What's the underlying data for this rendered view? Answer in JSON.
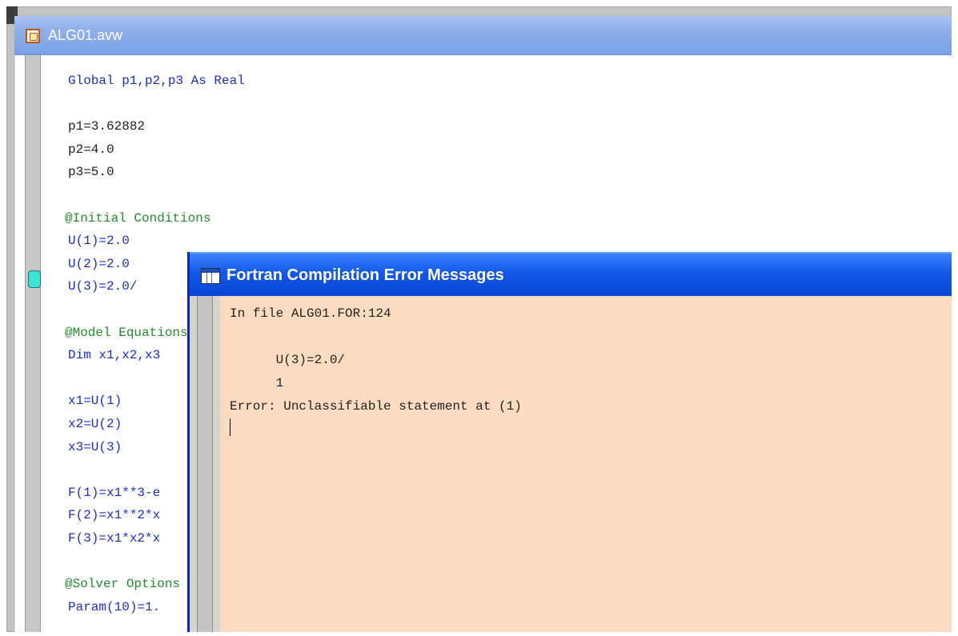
{
  "editor": {
    "title": "ALG01.avw",
    "lines": [
      {
        "text": "Global p1,p2,p3 As Real",
        "color": "blue",
        "indent": 0
      },
      {
        "text": "",
        "color": "black",
        "indent": 0
      },
      {
        "text": "p1=3.62882",
        "color": "black",
        "indent": 0
      },
      {
        "text": "p2=4.0",
        "color": "black",
        "indent": 0
      },
      {
        "text": "p3=5.0",
        "color": "black",
        "indent": 0
      },
      {
        "text": "",
        "color": "black",
        "indent": 0
      },
      {
        "text": "@Initial Conditions",
        "color": "green",
        "indent": -1
      },
      {
        "text": "U(1)=2.0",
        "color": "blue",
        "indent": 0
      },
      {
        "text": "U(2)=2.0",
        "color": "blue",
        "indent": 0
      },
      {
        "text": "U(3)=2.0/",
        "color": "blue",
        "indent": 0
      },
      {
        "text": "",
        "color": "black",
        "indent": 0
      },
      {
        "text": "@Model Equations",
        "color": "green",
        "indent": -1
      },
      {
        "text": "Dim x1,x2,x3",
        "color": "blue",
        "indent": 0
      },
      {
        "text": "",
        "color": "black",
        "indent": 0
      },
      {
        "text": "x1=U(1)",
        "color": "blue",
        "indent": 0
      },
      {
        "text": "x2=U(2)",
        "color": "blue",
        "indent": 0
      },
      {
        "text": "x3=U(3)",
        "color": "blue",
        "indent": 0
      },
      {
        "text": "",
        "color": "black",
        "indent": 0
      },
      {
        "text": "F(1)=x1**3-e",
        "color": "blue",
        "indent": 0
      },
      {
        "text": "F(2)=x1**2*x",
        "color": "blue",
        "indent": 0
      },
      {
        "text": "F(3)=x1*x2*x",
        "color": "blue",
        "indent": 0
      },
      {
        "text": "",
        "color": "black",
        "indent": 0
      },
      {
        "text": "@Solver Options",
        "color": "green",
        "indent": -1
      },
      {
        "text": "Param(10)=1.",
        "color": "blue",
        "indent": 0
      }
    ]
  },
  "error_dialog": {
    "title": "Fortran Compilation Error Messages",
    "lines": [
      "In file ALG01.FOR:124",
      "",
      "      U(3)=2.0/",
      "      1",
      "Error: Unclassifiable statement at (1)"
    ]
  },
  "colors": {
    "blue": "#1b2bd6",
    "green": "#238a2c",
    "black": "#202020",
    "dialog_background": "#fcdcc0",
    "titlebar_active": "#1157e8"
  }
}
